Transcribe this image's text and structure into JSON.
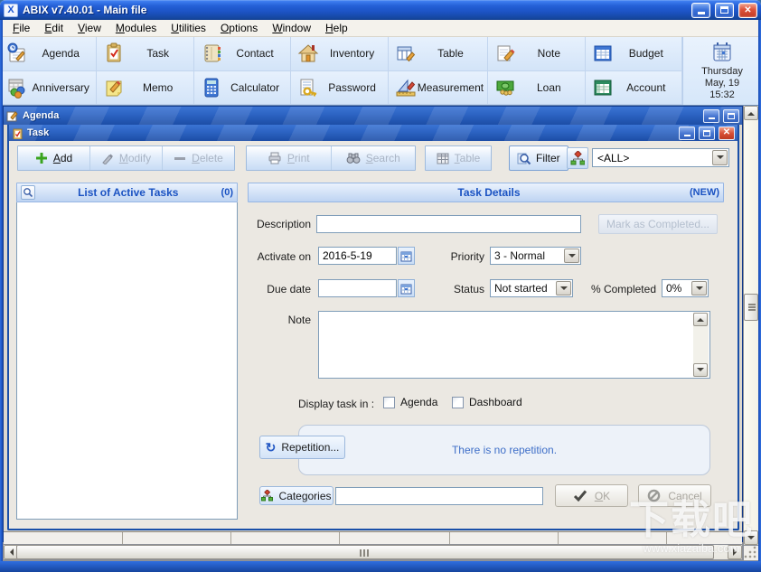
{
  "window": {
    "title": "ABIX v7.40.01 - Main file",
    "logo_glyph": "X"
  },
  "menu": {
    "items": [
      {
        "key": "F",
        "rest": "ile"
      },
      {
        "key": "E",
        "rest": "dit"
      },
      {
        "key": "V",
        "rest": "iew"
      },
      {
        "key": "M",
        "rest": "odules"
      },
      {
        "key": "U",
        "rest": "tilities"
      },
      {
        "key": "O",
        "rest": "ptions"
      },
      {
        "key": "W",
        "rest": "indow"
      },
      {
        "key": "H",
        "rest": "elp"
      }
    ]
  },
  "modules_toolbar": {
    "row1": [
      {
        "label": "Agenda",
        "icon": "agenda-icon"
      },
      {
        "label": "Task",
        "icon": "task-icon"
      },
      {
        "label": "Contact",
        "icon": "contact-icon"
      },
      {
        "label": "Inventory",
        "icon": "inventory-icon"
      },
      {
        "label": "Table",
        "icon": "table-icon"
      },
      {
        "label": "Note",
        "icon": "note-icon"
      },
      {
        "label": "Budget",
        "icon": "budget-icon"
      }
    ],
    "row2": [
      {
        "label": "Anniversary",
        "icon": "anniversary-icon"
      },
      {
        "label": "Memo",
        "icon": "memo-icon"
      },
      {
        "label": "Calculator",
        "icon": "calculator-icon"
      },
      {
        "label": "Password",
        "icon": "password-icon"
      },
      {
        "label": "Measurement",
        "icon": "measurement-icon"
      },
      {
        "label": "Loan",
        "icon": "loan-icon"
      },
      {
        "label": "Account",
        "icon": "account-icon"
      }
    ],
    "clock": {
      "day": "Thursday",
      "date": "May, 19",
      "time": "15:32",
      "icon": "calendar-icon"
    }
  },
  "agenda_window": {
    "title": "Agenda"
  },
  "task_window": {
    "title": "Task",
    "toolbar": {
      "add": {
        "key": "A",
        "rest": "dd",
        "icon": "plus-icon"
      },
      "modify": {
        "key": "M",
        "rest": "odify",
        "icon": "pencil-icon"
      },
      "delete": {
        "key": "D",
        "rest": "elete",
        "icon": "minus-icon"
      },
      "print": {
        "key": "P",
        "rest": "rint",
        "icon": "printer-icon"
      },
      "search": {
        "key": "S",
        "rest": "earch",
        "icon": "binoculars-icon"
      },
      "table": {
        "key": "T",
        "rest": "able",
        "icon": "grid-icon"
      },
      "filter_label": "Filter",
      "filter_icon": "magnifier-icon",
      "category_icon": "category-tree-icon",
      "category_value": "<ALL>"
    },
    "list_panel": {
      "title": "List of Active Tasks",
      "count": "(0)",
      "icon": "magnifier-icon"
    },
    "details": {
      "title": "Task Details",
      "state": "(NEW)",
      "description_label": "Description",
      "description_value": "",
      "mark_completed_label": "Mark as Completed...",
      "activate_on_label": "Activate on",
      "activate_on_value": "2016-5-19",
      "priority_label": "Priority",
      "priority_value": "3 - Normal",
      "due_date_label": "Due date",
      "due_date_value": "",
      "status_label": "Status",
      "status_value": "Not started",
      "percent_label": "% Completed",
      "percent_value": "0%",
      "note_label": "Note",
      "display_in_label": "Display task in :",
      "checkbox_agenda_label": "Agenda",
      "checkbox_dashboard_label": "Dashboard",
      "repetition_button_label": "Repetition...",
      "repetition_icon": "repeat-icon",
      "repetition_status": "There is no repetition.",
      "categories_button": {
        "key": "C",
        "rest": "ategories",
        "icon": "category-tree-icon"
      },
      "categories_value": "",
      "ok_button": {
        "key": "O",
        "rest": "K",
        "icon": "check-icon"
      },
      "cancel_label": "Cancel",
      "cancel_icon": "no-entry-icon"
    }
  },
  "watermark": {
    "title": "下载吧",
    "url": "www.xiazaiba.com"
  },
  "colors": {
    "titlebar_blue": "#1c53c4",
    "toolbar_blue": "#d9e7fa",
    "panel_header_blue": "#bed4f2",
    "header_text_blue": "#1a52c2",
    "close_red": "#dd5139",
    "content_gray": "#ebe8e2"
  }
}
